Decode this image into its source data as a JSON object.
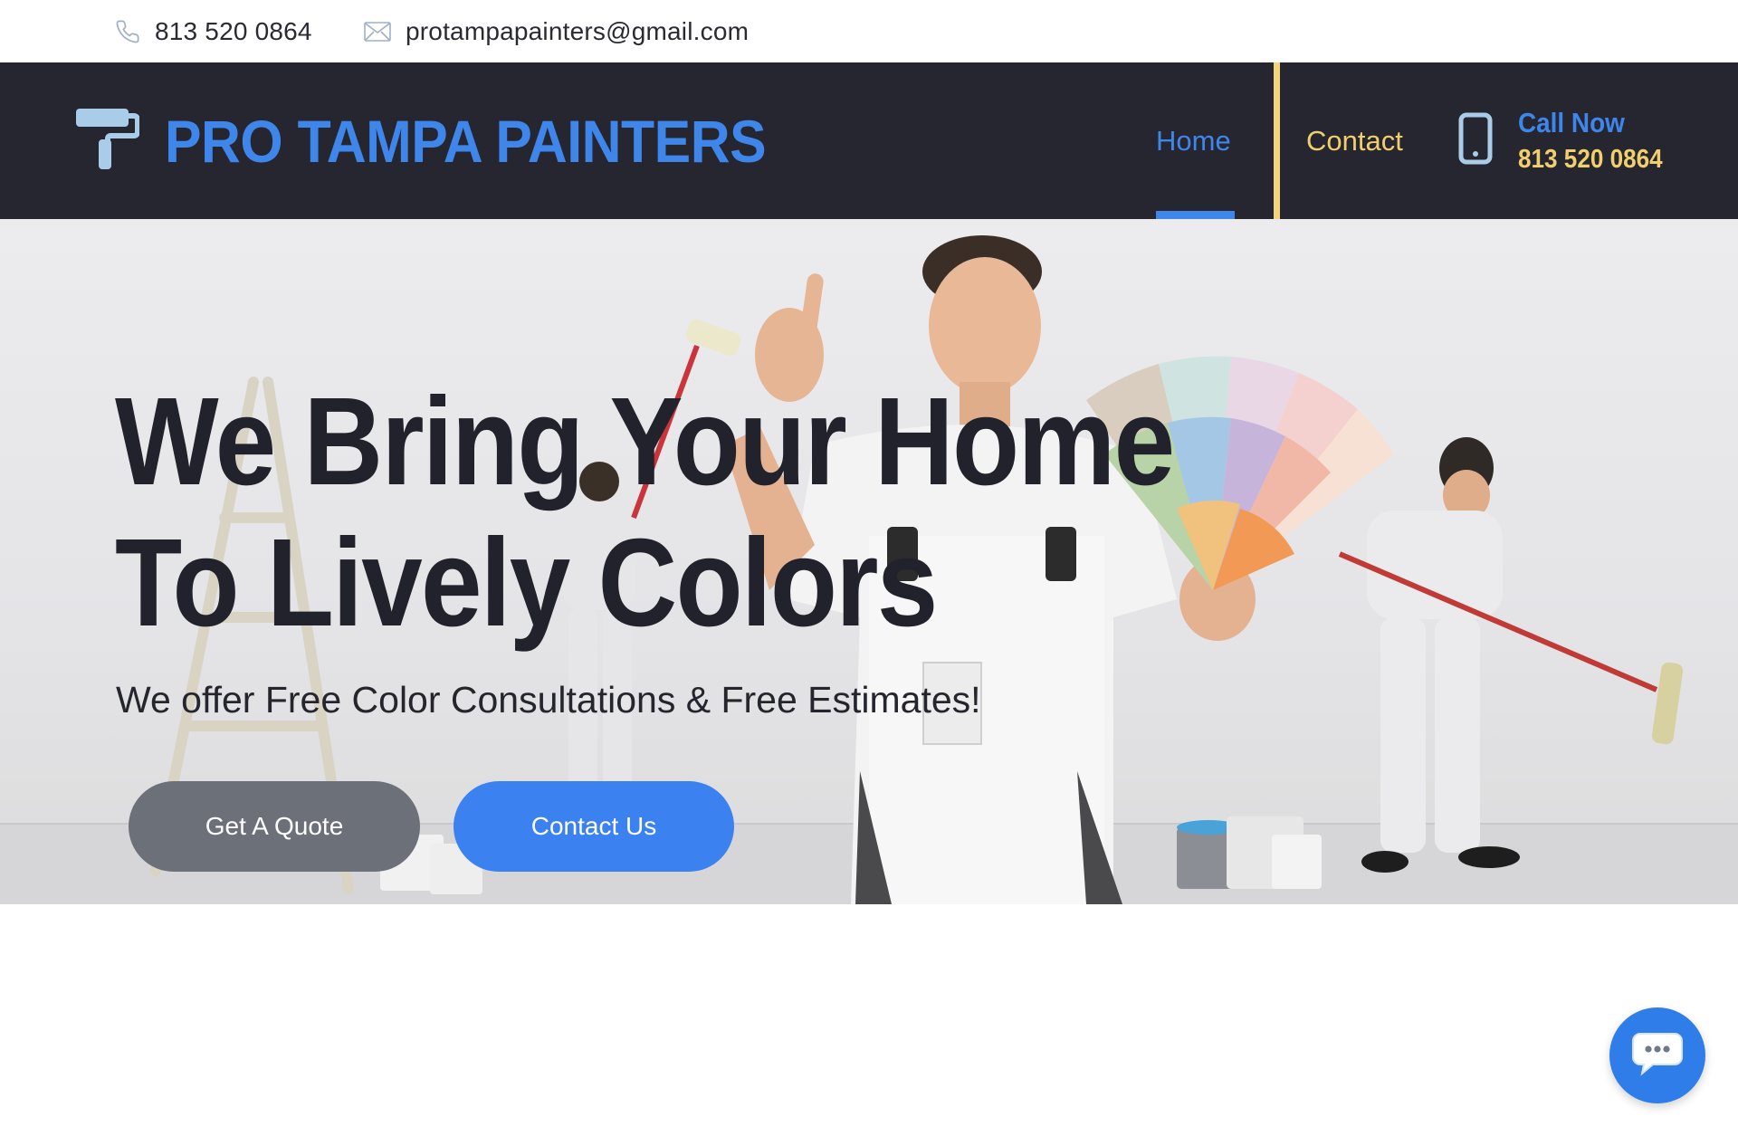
{
  "topbar": {
    "phone": "813 520 0864",
    "email": "protampapainters@gmail.com",
    "phone_icon": "phone-icon",
    "email_icon": "envelope-icon"
  },
  "header": {
    "logo_icon": "paint-roller-icon",
    "logo_text": "PRO TAMPA PAINTERS",
    "nav": [
      {
        "label": "Home",
        "active": true
      },
      {
        "label": "Contact",
        "active": false
      }
    ],
    "call": {
      "icon": "mobile-phone-icon",
      "label": "Call Now",
      "number": "813 520 0864"
    }
  },
  "hero": {
    "title_line1": "We Bring Your Home",
    "title_line2": "To Lively Colors",
    "subtitle": "We offer Free Color Consultations & Free Estimates!",
    "buttons": {
      "quote": "Get A Quote",
      "contact": "Contact Us"
    }
  },
  "chat": {
    "icon": "chat-bubble-icon"
  },
  "colors": {
    "brand_blue": "#3f86ea",
    "accent_yellow": "#f0cf6c",
    "header_bg": "#262631",
    "button_gray": "#6b7079",
    "button_blue": "#3b82f0"
  }
}
